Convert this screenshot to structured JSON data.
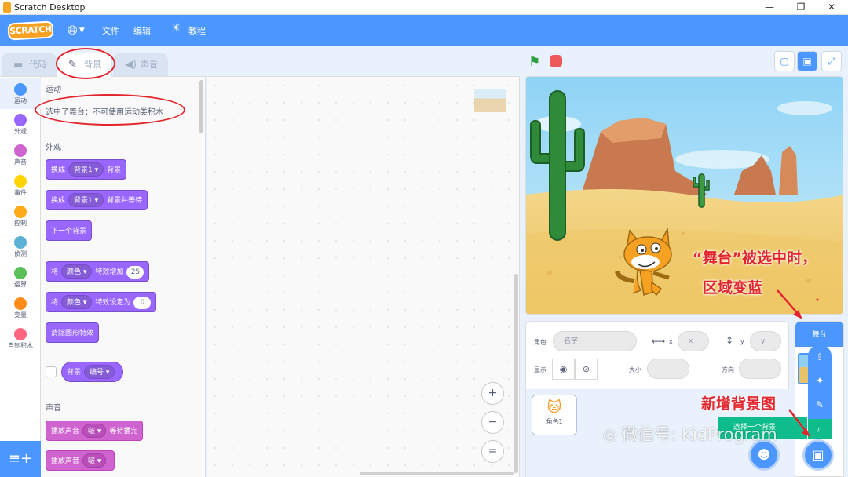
{
  "window": {
    "title": "Scratch Desktop",
    "minimize": "—",
    "maximize": "❐",
    "close": "✕"
  },
  "menu": {
    "logo": "SCRATCH",
    "file": "文件",
    "edit": "编辑",
    "tutorials": "教程"
  },
  "tabs": [
    {
      "label": "代码",
      "icon": "code-icon"
    },
    {
      "label": "背景",
      "icon": "brush-icon"
    },
    {
      "label": "声音",
      "icon": "speaker-icon"
    }
  ],
  "categories": [
    {
      "label": "运动",
      "color": "#4c97ff"
    },
    {
      "label": "外观",
      "color": "#9966ff"
    },
    {
      "label": "声音",
      "color": "#cf63cf"
    },
    {
      "label": "事件",
      "color": "#ffd500"
    },
    {
      "label": "控制",
      "color": "#ffab19"
    },
    {
      "label": "侦测",
      "color": "#5cb1d6"
    },
    {
      "label": "运算",
      "color": "#59c059"
    },
    {
      "label": "变量",
      "color": "#ff8c1a"
    },
    {
      "label": "自制积木",
      "color": "#ff6680"
    }
  ],
  "palette": {
    "motion_heading": "运动",
    "motion_note": "选中了舞台：不可使用运动类积木",
    "looks_heading": "外观",
    "blocks_looks": [
      {
        "pre": "换成",
        "dropdown": "背景1",
        "post": "背景"
      },
      {
        "pre": "换成",
        "dropdown": "背景1",
        "post": "背景并等待"
      },
      {
        "pre": "下一个背景",
        "dropdown": "",
        "post": ""
      },
      {
        "pre": "将",
        "dropdown": "颜色",
        "post": "特效增加",
        "num": "25"
      },
      {
        "pre": "将",
        "dropdown": "颜色",
        "post": "特效设定为",
        "num": "0"
      },
      {
        "pre": "清除图形特效",
        "dropdown": "",
        "post": ""
      }
    ],
    "reporter": {
      "pre": "背景",
      "dropdown": "编号"
    },
    "sound_heading": "声音",
    "blocks_sound": [
      {
        "pre": "播放声音",
        "dropdown": "啵",
        "post": "等待播完"
      },
      {
        "pre": "播放声音",
        "dropdown": "啵",
        "post": ""
      }
    ]
  },
  "zoom": {
    "in": "+",
    "out": "−",
    "reset": "="
  },
  "sprite_info": {
    "sprite_label": "角色",
    "sprite_placeholder": "名字",
    "x_label": "x",
    "x_value": "x",
    "y_label": "y",
    "y_value": "y",
    "show_label": "显示",
    "size_label": "大小",
    "direction_label": "方向"
  },
  "sprites": [
    {
      "name": "角色1"
    }
  ],
  "stage_pane": {
    "label": "舞台",
    "choose_backdrop": "选择一个背景"
  },
  "annotations": {
    "stage_selected_line1": "“舞台”被选中时，",
    "stage_selected_line2": "区域变蓝",
    "new_backdrop": "新增背景图"
  },
  "watermark": "微信号: KidProgram"
}
